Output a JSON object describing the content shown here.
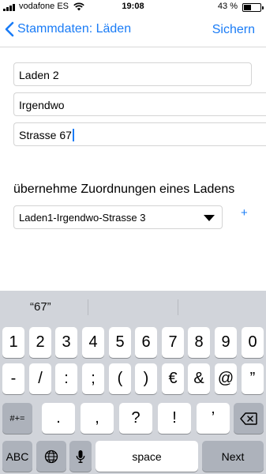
{
  "status_bar": {
    "carrier": "vodafone ES",
    "time": "19:08",
    "battery_percent": "43 %",
    "battery_level": 0.43,
    "signal_bars": 4
  },
  "nav": {
    "back_label": "Stammdaten: Läden",
    "save_label": "Sichern"
  },
  "form": {
    "name_value": "Laden 2",
    "city_value": "Irgendwo",
    "street_value": "Strasse 67",
    "assignment_label": "übernehme Zuordnungen eines Ladens",
    "assignment_selected": "Laden1-Irgendwo-Strasse 3",
    "add_label": "+"
  },
  "keyboard": {
    "prediction": "“67”",
    "row1": [
      "1",
      "2",
      "3",
      "4",
      "5",
      "6",
      "7",
      "8",
      "9",
      "0"
    ],
    "row2": [
      "-",
      "/",
      ":",
      ";",
      "(",
      ")",
      "€",
      "&",
      "@",
      "”"
    ],
    "row3_toggle": "#+=",
    "row3": [
      ".",
      ",",
      "?",
      "!",
      "’"
    ],
    "abc_label": "ABC",
    "space_label": "space",
    "next_label": "Next"
  },
  "colors": {
    "accent": "#1a7cf6",
    "keyboard_bg": "#d1d4da",
    "key_dark": "#adb2bb"
  }
}
